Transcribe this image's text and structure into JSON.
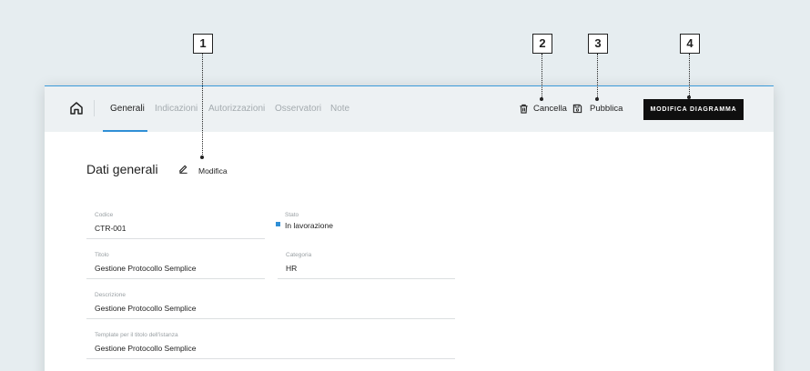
{
  "callouts": [
    "1",
    "2",
    "3",
    "4"
  ],
  "nav": {
    "home_icon": "home-icon",
    "tabs": [
      {
        "label": "Generali",
        "active": true
      },
      {
        "label": "Indicazioni",
        "active": false
      },
      {
        "label": "Autorizzazioni",
        "active": false
      },
      {
        "label": "Osservatori",
        "active": false
      },
      {
        "label": "Note",
        "active": false
      }
    ]
  },
  "actions": {
    "delete_label": "Cancella",
    "delete_icon": "trash-icon",
    "publish_label": "Pubblica",
    "publish_icon": "save-icon",
    "edit_diagram_label": "MODIFICA DIAGRAMMA"
  },
  "section": {
    "title": "Dati generali",
    "edit_label": "Modifica",
    "edit_icon": "pencil-icon"
  },
  "fields": {
    "codice": {
      "label": "Codice",
      "value": "CTR-001"
    },
    "stato": {
      "label": "Stato",
      "value": "In lavorazione"
    },
    "titolo": {
      "label": "Titolo",
      "value": "Gestione Protocollo Semplice"
    },
    "categoria": {
      "label": "Categoria",
      "value": "HR"
    },
    "descrizione": {
      "label": "Descrizione",
      "value": "Gestione Protocollo Semplice"
    },
    "template": {
      "label": "Template per il titolo dell'istanza",
      "value": "Gestione Protocollo Semplice"
    }
  },
  "colors": {
    "accent": "#2f8fd6",
    "primary_button": "#0f0f0f",
    "topbar": "#edf1f3",
    "background": "#e6edf0"
  }
}
